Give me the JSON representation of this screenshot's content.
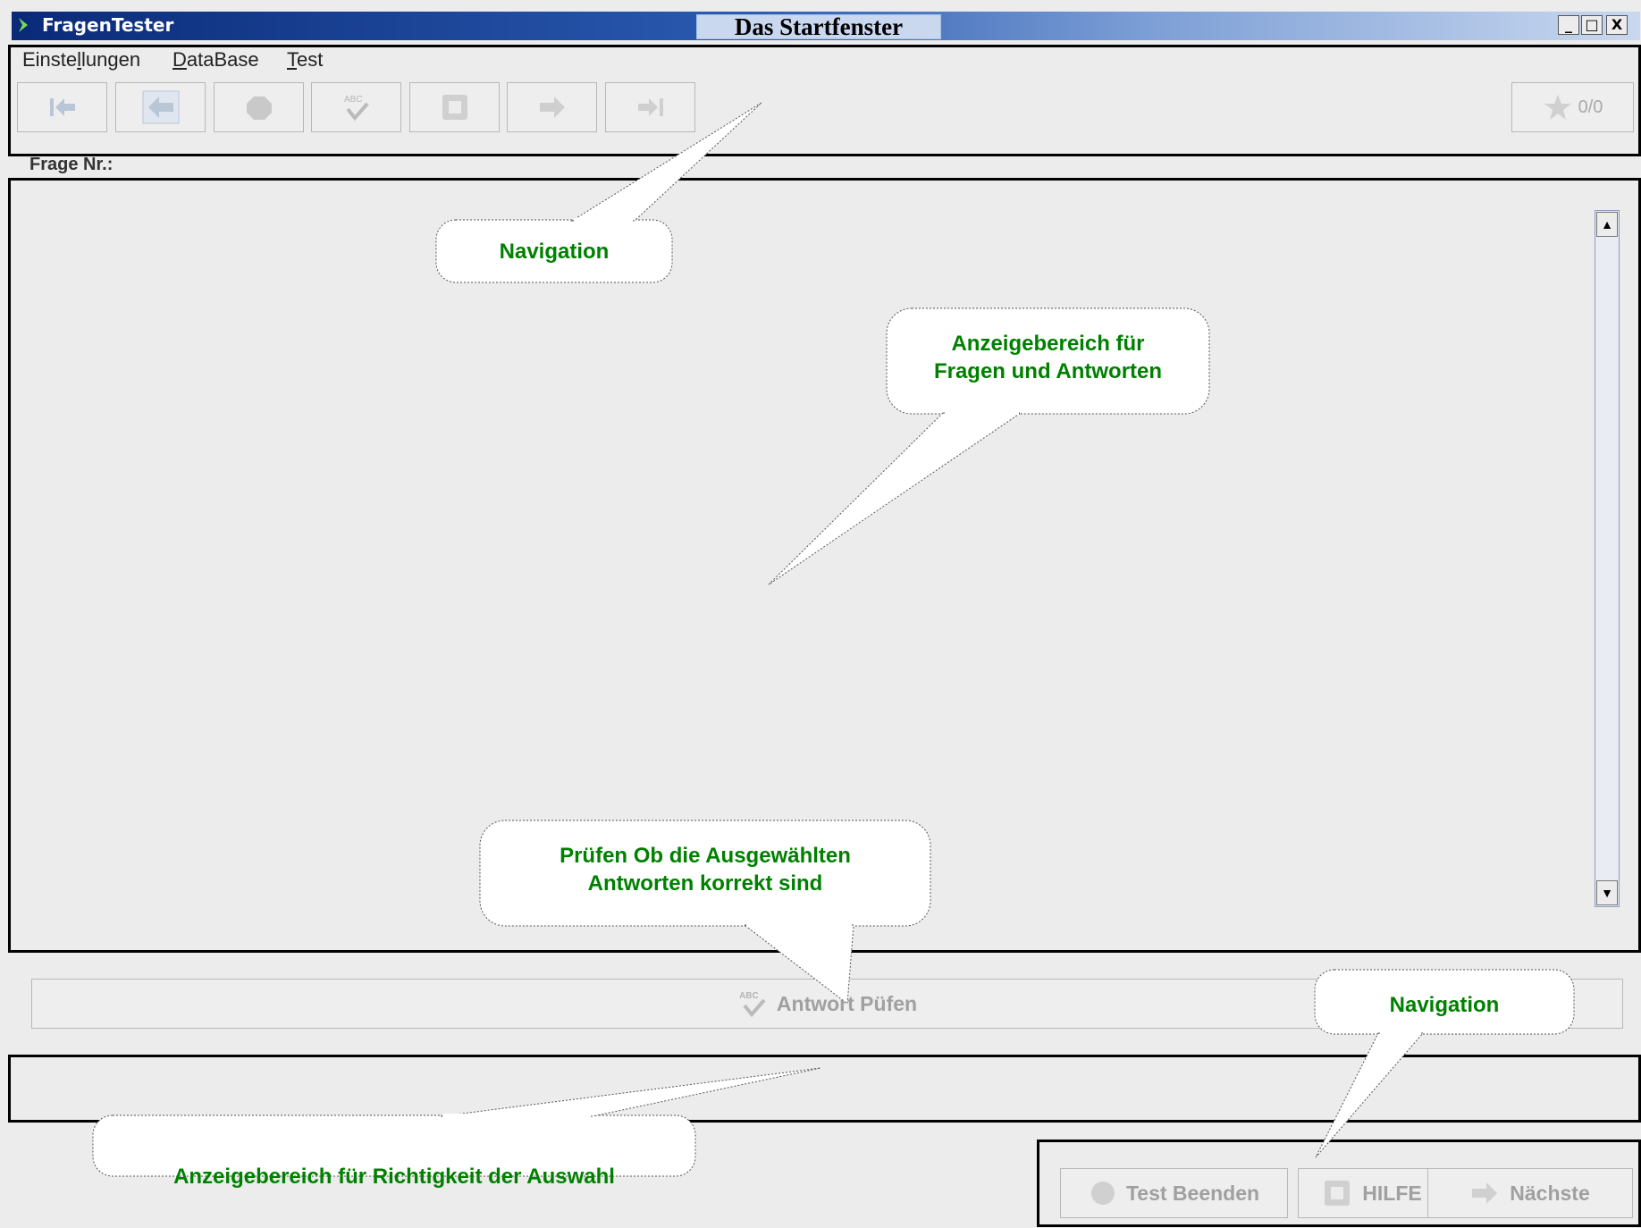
{
  "window": {
    "app_title": "FragenTester",
    "caption": "Das Startfenster",
    "minimize_symbol": "_",
    "maximize_symbol": "□",
    "close_symbol": "X"
  },
  "menu": {
    "items": [
      {
        "pre": "Einste",
        "u": "l",
        "post": "lungen"
      },
      {
        "pre": "",
        "u": "D",
        "post": "ataBase"
      },
      {
        "pre": "",
        "u": "T",
        "post": "est"
      }
    ]
  },
  "toolbar": {
    "icons": [
      "first-icon",
      "back-icon",
      "stop-icon",
      "spellcheck-icon",
      "help-icon",
      "next-icon",
      "last-icon"
    ],
    "score_label": "0/0"
  },
  "question": {
    "label": "Frage Nr.:"
  },
  "check_button": {
    "label": "Antwort Püfen",
    "icon_text": "ABC"
  },
  "bottom_buttons": {
    "end_label": "Test Beenden",
    "help_label": "HILFE",
    "next_label": "Nächste"
  },
  "callouts": {
    "nav_top": "Navigation",
    "display_area_line1": "Anzeigebereich für",
    "display_area_line2": "Fragen und Antworten",
    "check_line1": "Prüfen Ob die Ausgewählten",
    "check_line2": "Antworten korrekt sind",
    "nav_bottom": "Navigation",
    "result_area": "Anzeigebereich für Richtigkeit der Auswahl"
  },
  "colors": {
    "callout_text": "#008000",
    "titlebar_dark": "#0a2a78",
    "disabled_text": "#a0a0a0"
  }
}
